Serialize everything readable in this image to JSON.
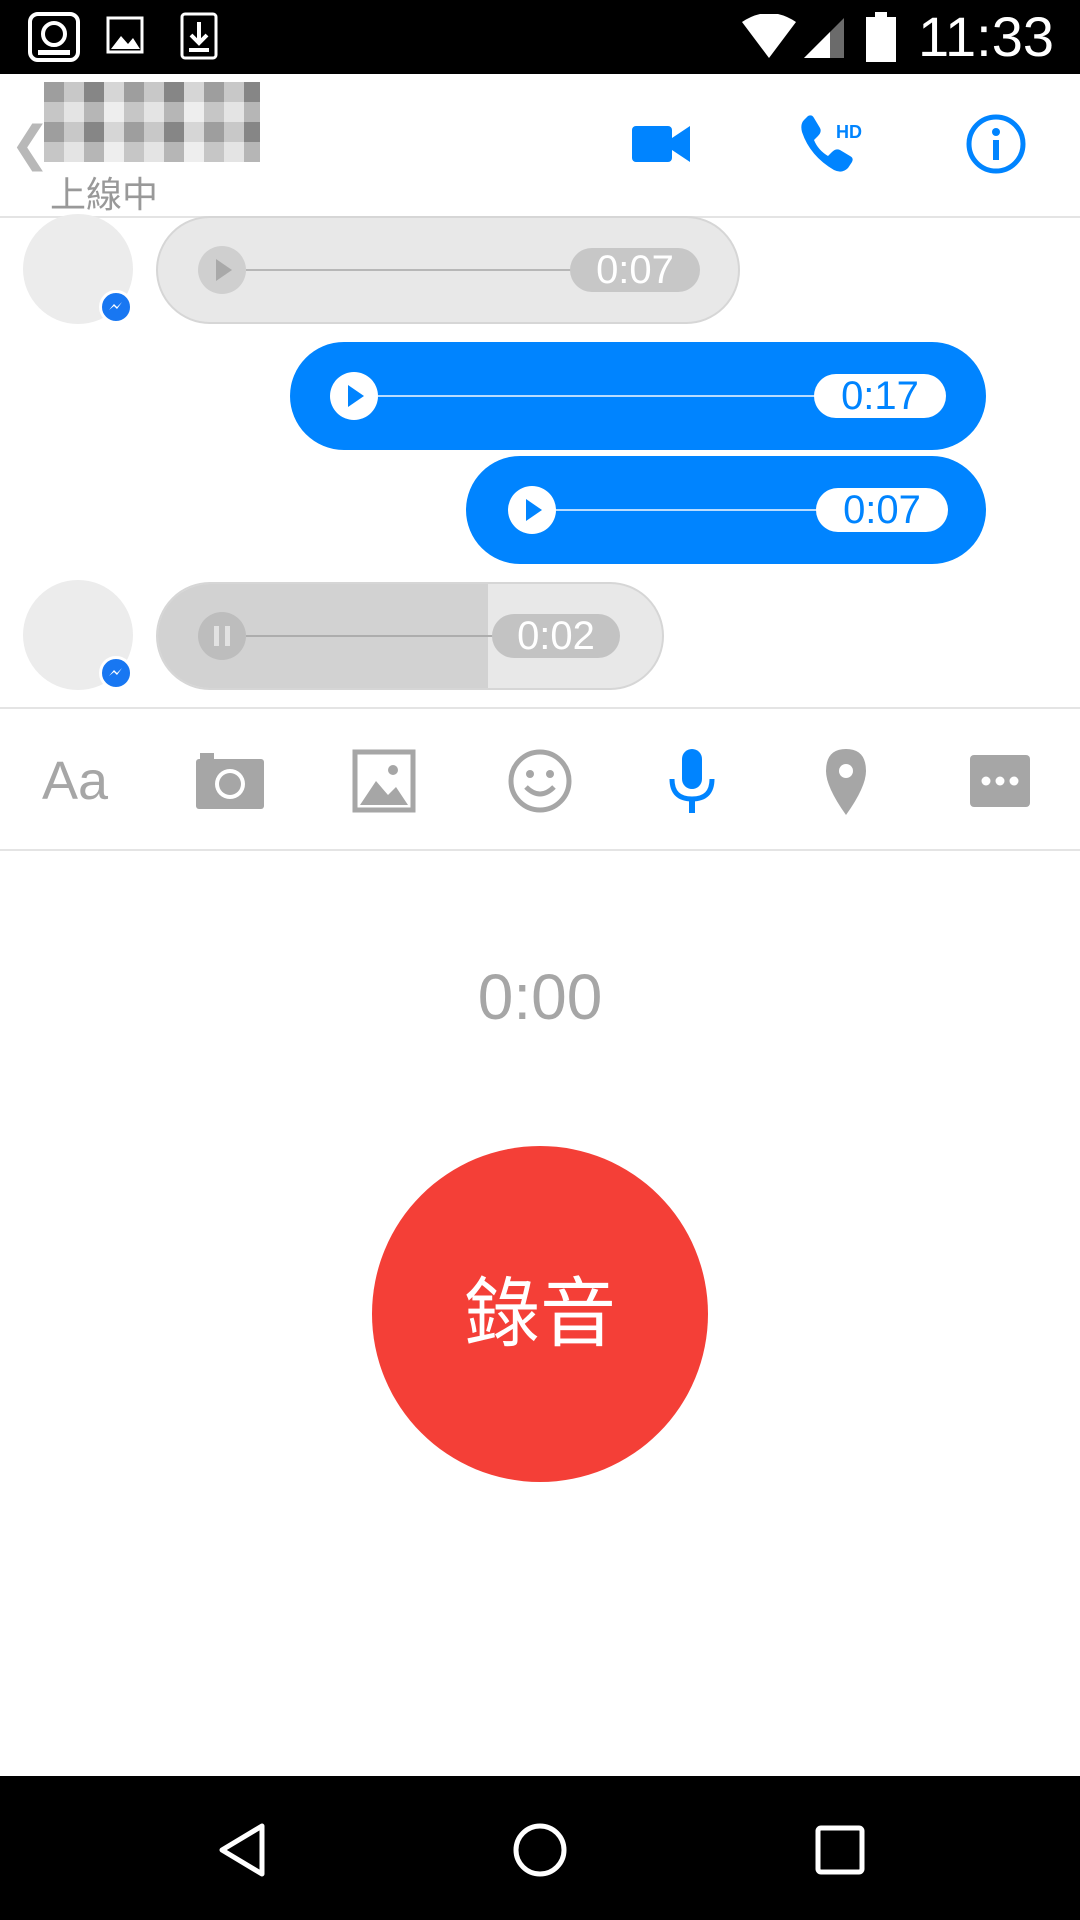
{
  "status_bar": {
    "time": "11:33",
    "icons": [
      "app-icon",
      "image-icon",
      "download-icon",
      "wifi-icon",
      "signal-icon",
      "battery-icon"
    ]
  },
  "header": {
    "presence": "上線中",
    "actions": [
      "video-call-icon",
      "hd-call-icon",
      "info-icon"
    ],
    "hd_label": "HD"
  },
  "messages": [
    {
      "side": "in",
      "duration": "0:07",
      "state": "paused"
    },
    {
      "side": "out",
      "duration": "0:17",
      "state": "paused"
    },
    {
      "side": "out",
      "duration": "0:07",
      "state": "paused"
    },
    {
      "side": "in",
      "duration": "0:02",
      "state": "playing"
    }
  ],
  "toolbar": {
    "text_label": "Aa",
    "items": [
      "text-icon",
      "camera-icon",
      "gallery-icon",
      "emoji-icon",
      "microphone-icon",
      "location-icon",
      "more-icon"
    ]
  },
  "recorder": {
    "timer": "0:00",
    "record_label": "錄音"
  },
  "colors": {
    "accent": "#0084ff",
    "record": "#f43f37",
    "incoming_bubble": "#e8e8e8"
  }
}
